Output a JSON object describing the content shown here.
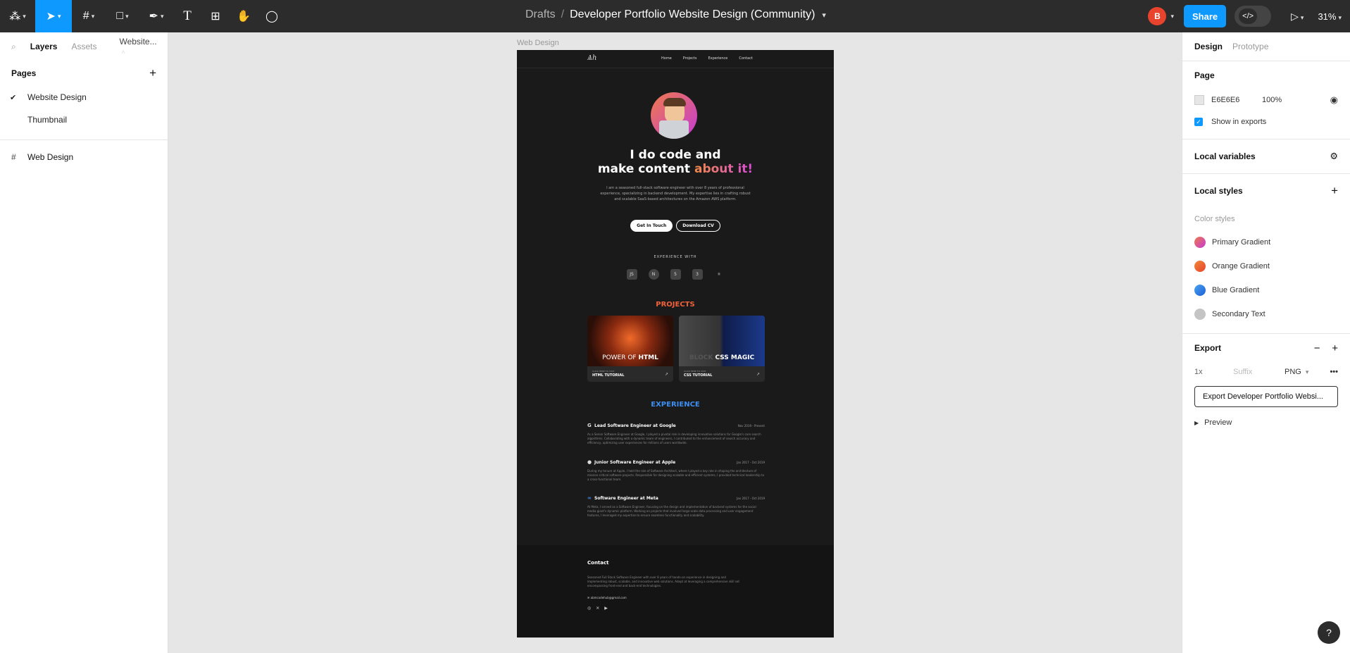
{
  "topbar": {
    "breadcrumb_parent": "Drafts",
    "breadcrumb_sep": "/",
    "file_name": "Developer Portfolio Website Design (Community)",
    "user_initial": "B",
    "share_label": "Share",
    "zoom": "31%"
  },
  "left_panel": {
    "tab_layers": "Layers",
    "tab_assets": "Assets",
    "tab_page": "Website...",
    "pages_heading": "Pages",
    "pages": [
      "Website Design",
      "Thumbnail"
    ],
    "layers": [
      "Web Design"
    ]
  },
  "canvas": {
    "frame_label": "Web Design",
    "site": {
      "logo": "Ѧh",
      "nav": [
        "Home",
        "Projects",
        "Experience",
        "Contact"
      ],
      "headline_line1": "I do code and",
      "headline_line2_plain": "make content ",
      "headline_line2_accent": "about it!",
      "intro": "I am a seasoned full-stack software engineer with over 8 years of professional experience, specializing in backend development. My expertise lies in crafting robust and scalable SaaS-based architectures on the Amazon AWS platform.",
      "btn_primary": "Get In Touch",
      "btn_secondary": "Download CV",
      "experience_with": "EXPERIENCE WITH",
      "tech_icons": [
        "JS",
        "N",
        "5",
        "3",
        "⚛"
      ],
      "projects_title": "PROJECTS",
      "projects": [
        {
          "art_text_plain": "POWER OF ",
          "art_text_bold": "HTML",
          "sub": "CLICK HERE TO VISIT",
          "title": "HTML TUTORIAL"
        },
        {
          "art_text_plain": "BLOCK ",
          "art_text_bold": "CSS MAGIC",
          "sub": "CLICK HERE TO VISIT",
          "title": "CSS TUTORIAL"
        }
      ],
      "experience_title": "EXPERIENCE",
      "jobs": [
        {
          "icon": "G",
          "title": "Lead Software Engineer at Google",
          "date": "Nov 2019 - Present",
          "desc": "As a Senior Software Engineer at Google, I played a pivotal role in developing innovative solutions for Google's core search algorithms. Collaborating with a dynamic team of engineers, I contributed to the enhancement of search accuracy and efficiency, optimizing user experiences for millions of users worldwide."
        },
        {
          "icon": "",
          "title": "Junior Software Engineer at Apple",
          "date": "Jan 2017 - Oct 2019",
          "desc": "During my tenure at Apple, I held the role of Software Architect, where I played a key role in shaping the architecture of mission-critical software projects. Responsible for designing scalable and efficient systems, I provided technical leadership to a cross-functional team."
        },
        {
          "icon": "∞",
          "title": "Software Engineer at Meta",
          "date": "Jan 2017 - Oct 2019",
          "desc": "At Meta, I served as a Software Engineer, focusing on the design and implementation of backend systems for the social media giant's dynamic platform. Working on projects that involved large-scale data processing and user engagement features, I leveraged my expertise to ensure seamless functionality and scalability."
        }
      ],
      "contact_title": "Contact",
      "contact_text": "Seasoned Full Stack Software Engineer with over 8 years of hands-on experience in designing and implementing robust, scalable, and innovative web solutions. Adept at leveraging a comprehensive skill set encompassing front-end and back-end technologies.",
      "contact_email": "abmcodehub@gmail.com",
      "socials": [
        "◎",
        "✕",
        "▶"
      ]
    }
  },
  "right_panel": {
    "tab_design": "Design",
    "tab_prototype": "Prototype",
    "page_heading": "Page",
    "page_color": "E6E6E6",
    "page_opacity": "100%",
    "show_exports": "Show in exports",
    "local_variables": "Local variables",
    "local_styles": "Local styles",
    "color_styles_heading": "Color styles",
    "color_styles": [
      {
        "name": "Primary Gradient",
        "color": "linear-gradient(135deg,#f07a4a,#c43bd6)"
      },
      {
        "name": "Orange Gradient",
        "color": "linear-gradient(135deg,#f08a3a,#e8432d)"
      },
      {
        "name": "Blue Gradient",
        "color": "linear-gradient(135deg,#4aa3f0,#1c5fd6)"
      },
      {
        "name": "Secondary Text",
        "color": "#c4c4c4"
      }
    ],
    "export_heading": "Export",
    "export_scale": "1x",
    "export_suffix_placeholder": "Suffix",
    "export_format": "PNG",
    "export_button": "Export Developer Portfolio Websi...",
    "preview": "Preview"
  },
  "colors": {
    "accent": "#0d99ff",
    "toolbar": "#2c2c2c",
    "canvas": "#e6e6e6"
  }
}
